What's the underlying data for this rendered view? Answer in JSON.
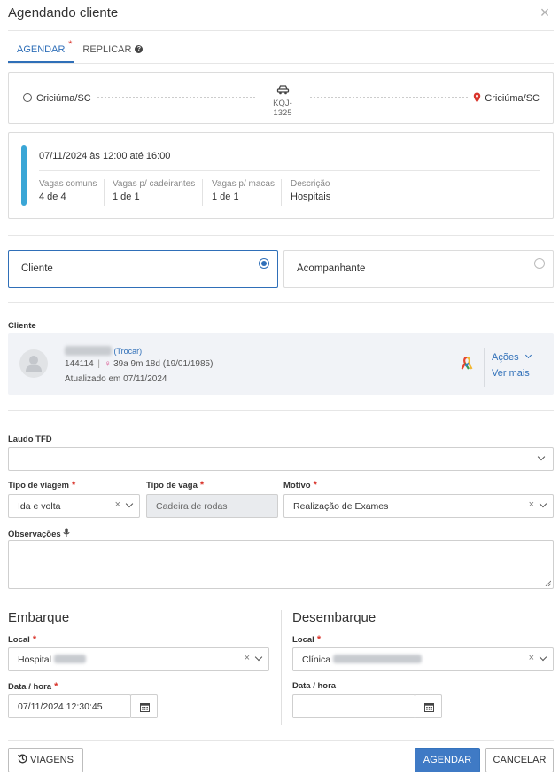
{
  "dialog": {
    "title": "Agendando cliente",
    "close_label": "×"
  },
  "tabs": [
    {
      "label": "AGENDAR",
      "required": "*"
    },
    {
      "label": "REPLICAR"
    }
  ],
  "route": {
    "origin": "Criciúma/SC",
    "destination": "Criciúma/SC",
    "vehicle_plate": "KQJ-1325"
  },
  "trip": {
    "datetime_range": "07/11/2024 às 12:00 até 16:00",
    "accent_color": "#3aa6d6",
    "stats": [
      {
        "label": "Vagas comuns",
        "value": "4 de 4"
      },
      {
        "label": "Vagas p/ cadeirantes",
        "value": "1 de 1"
      },
      {
        "label": "Vagas p/ macas",
        "value": "1 de 1"
      },
      {
        "label": "Descrição",
        "value": "Hospitais"
      }
    ]
  },
  "passenger_type": {
    "options": [
      {
        "label": "Cliente",
        "selected": true
      },
      {
        "label": "Acompanhante",
        "selected": false
      }
    ]
  },
  "client": {
    "section_label": "Cliente",
    "change_link": "(Trocar)",
    "id": "144114",
    "age_info": "39a 9m 18d (19/01/1985)",
    "updated": "Atualizado em 07/11/2024",
    "actions_label": "Ações",
    "more_label": "Ver mais"
  },
  "form": {
    "laudo_label": "Laudo TFD",
    "laudo_value": "",
    "tipo_viagem_label": "Tipo de viagem",
    "tipo_viagem_value": "Ida e volta",
    "tipo_vaga_label": "Tipo de vaga",
    "tipo_vaga_value": "Cadeira de rodas",
    "motivo_label": "Motivo",
    "motivo_value": "Realização de Exames",
    "observacoes_label": "Observações",
    "observacoes_value": "",
    "required_mark": "*",
    "clear_mark": "×"
  },
  "embarque": {
    "title": "Embarque",
    "local_label": "Local",
    "local_value": "Hospital",
    "datahora_label": "Data / hora",
    "datahora_value": "07/11/2024 12:30:45"
  },
  "desembarque": {
    "title": "Desembarque",
    "local_label": "Local",
    "local_value": "Clínica",
    "datahora_label": "Data / hora",
    "datahora_value": ""
  },
  "footer": {
    "viagens_label": "VIAGENS",
    "agendar_label": "AGENDAR",
    "cancelar_label": "CANCELAR"
  },
  "colors": {
    "primary": "#3f7ac5",
    "required": "#d9342b",
    "link": "#2f6fb8",
    "female_symbol": "#d94c8a",
    "pin": "#d9342b"
  }
}
